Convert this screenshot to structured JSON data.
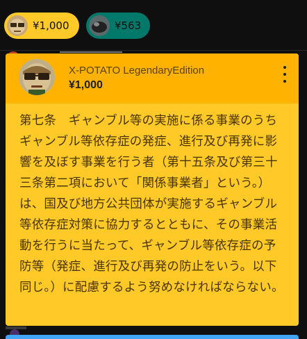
{
  "ticker": {
    "chips": [
      {
        "amount": "¥1,000",
        "color": "#ffca28"
      },
      {
        "amount": "¥563",
        "color": "#00796b"
      }
    ]
  },
  "superchat": {
    "author": "X-POTATO LegendaryEdition",
    "amount": "¥1,000",
    "header_color": "#ffb300",
    "body_color": "#ffca28",
    "message": "第七条　ギャンブル等の実施に係る事業のうちギャンブル等依存症の発症、進行及び再発に影響を及ぼす事業を行う者（第十五条及び第三十三条第二項において「関係事業者」という。）は、国及び地方公共団体が実施するギャンブル等依存症対策に協力するとともに、その事業活動を行うに当たって、ギャンブル等依存症の予防等（発症、進行及び再発の防止をいう。以下同じ。）に配慮するよう努めなければならない。"
  }
}
